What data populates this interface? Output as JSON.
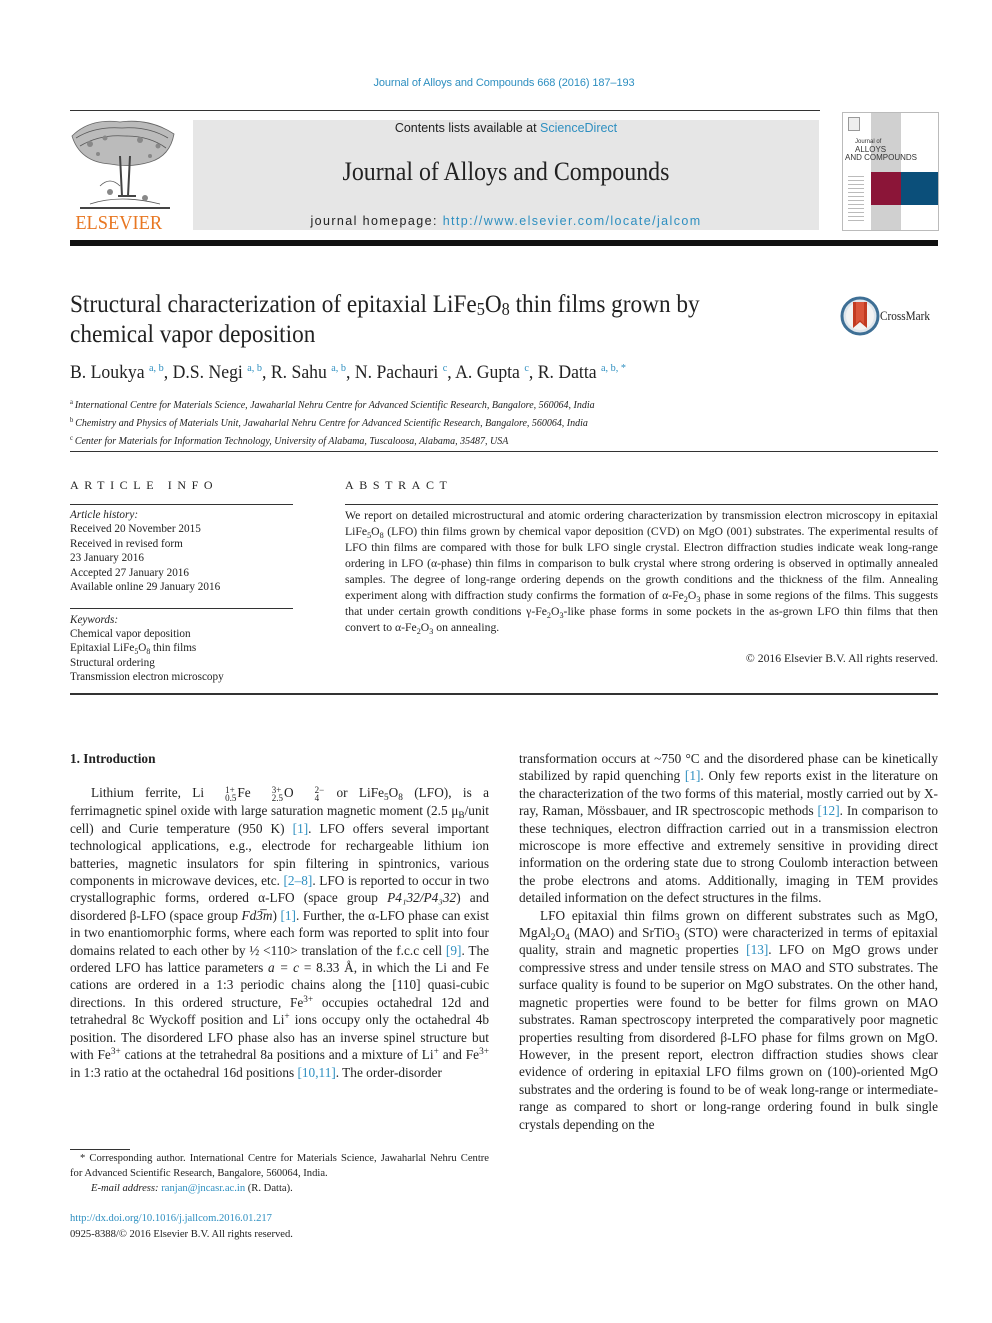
{
  "header": {
    "citation": "Journal of Alloys and Compounds 668 (2016) 187–193",
    "contents_prefix": "Contents lists available at ",
    "contents_link": "ScienceDirect",
    "journal_title": "Journal of Alloys and Compounds",
    "homepage_prefix": "journal homepage: ",
    "homepage_url": "http://www.elsevier.com/locate/jalcom",
    "publisher_logo_text": "ELSEVIER",
    "cover_line1": "Journal of",
    "cover_line2": "ALLOYS",
    "cover_line3": "AND COMPOUNDS",
    "colors": {
      "accent_link": "#2e8fc0",
      "elsevier_orange": "#e87722",
      "cover_red": "#8b1538",
      "cover_blue": "#0b4f7a",
      "masthead_gray": "#e6e6e6"
    }
  },
  "article": {
    "title_pre": "Structural characterization of epitaxial LiFe",
    "title_sub1": "5",
    "title_mid": "O",
    "title_sub2": "8",
    "title_post": " thin films grown by",
    "title_line2": "chemical vapor deposition",
    "crossmark_label": "CrossMark",
    "authors": [
      {
        "name": "B. Loukya",
        "aff": "a, b"
      },
      {
        "name": "D.S. Negi",
        "aff": "a, b"
      },
      {
        "name": "R. Sahu",
        "aff": "a, b"
      },
      {
        "name": "N. Pachauri",
        "aff": "c"
      },
      {
        "name": "A. Gupta",
        "aff": "c"
      },
      {
        "name": "R. Datta",
        "aff": "a, b, *"
      }
    ],
    "affiliations": [
      {
        "key": "a",
        "text": "International Centre for Materials Science, Jawaharlal Nehru Centre for Advanced Scientific Research, Bangalore, 560064, India"
      },
      {
        "key": "b",
        "text": "Chemistry and Physics of Materials Unit, Jawaharlal Nehru Centre for Advanced Scientific Research, Bangalore, 560064, India"
      },
      {
        "key": "c",
        "text": "Center for Materials for Information Technology, University of Alabama, Tuscaloosa, Alabama, 35487, USA"
      }
    ]
  },
  "article_info": {
    "heading": "ARTICLE INFO",
    "history_label": "Article history:",
    "history": [
      "Received 20 November 2015",
      "Received in revised form",
      "23 January 2016",
      "Accepted 27 January 2016",
      "Available online 29 January 2016"
    ],
    "keywords_label": "Keywords:",
    "keywords": [
      "Chemical vapor deposition",
      "Epitaxial LiFe5O8 thin films",
      "Structural ordering",
      "Transmission electron microscopy"
    ]
  },
  "abstract": {
    "heading": "ABSTRACT",
    "p1": "We report on detailed microstructural and atomic ordering characterization by transmission electron microscopy in epitaxial LiFe",
    "p2": "O",
    "p3": " (LFO) thin films grown by chemical vapor deposition (CVD) on MgO (001) substrates. The experimental results of LFO thin films are compared with those for bulk LFO single crystal. Electron diffraction studies indicate weak long-range ordering in LFO (α-phase) thin films in comparison to bulk crystal where strong ordering is observed in optimally annealed samples. The degree of long-range ordering depends on the growth conditions and the thickness of the film. Annealing experiment along with diffraction study confirms the formation of α-Fe",
    "p4": "O",
    "p5": " phase in some regions of the films. This suggests that under certain growth conditions γ-Fe",
    "p6": "O",
    "p7": "-like phase forms in some pockets in the as-grown LFO thin films that then convert to α-Fe",
    "p8": "O",
    "p9": " on annealing.",
    "copyright": "© 2016 Elsevier B.V. All rights reserved."
  },
  "body": {
    "section_title": "1.  Introduction",
    "refs": {
      "r1": "[1]",
      "r2_8": "[2–8]",
      "r9": "[9]",
      "r10_11": "[10,11]",
      "r12": "[12]",
      "r13": "[13]"
    },
    "left": {
      "s1": "Lithium ferrite, Li",
      "s2": " or LiFe",
      "s3": " (LFO), is a ferrimagnetic spinel oxide with large saturation magnetic moment (2.5 μ",
      "s4": "/unit cell) and Curie temperature (950 K) ",
      "s5": ". LFO offers several important technological applications, e.g., electrode for rechargeable lithium ion batteries, magnetic insulators for spin filtering in spintronics, various components in microwave devices, etc. ",
      "s6": ". LFO is reported to occur in two crystallographic forms, ordered α-LFO (space group ",
      "s7": "P4₁32/P4₃32",
      "s8": ") and disordered β-LFO (space group ",
      "s9": "Fd3̅m",
      "s10": ") ",
      "s11": ". Further, the α-LFO phase can exist in two enantiomorphic forms, where each form was reported to split into four domains related to each other by ½ <110> translation of the f.c.c cell ",
      "s12": ". The ordered LFO has lattice parameters ",
      "s13": "a = c",
      "s14": " = 8.33 Å, in which the Li and Fe cations are ordered in a 1:3 periodic chains along the [110] quasi-cubic directions. In this ordered structure, Fe",
      "s15": " occupies octahedral 12d and tetrahedral 8c Wyckoff position and Li",
      "s16": " ions occupy only the octahedral 4b position. The disordered LFO phase also has an inverse spinel structure but with Fe",
      "s17": " cations at the tetrahedral 8a positions and a mixture of Li",
      "s18": " and Fe",
      "s19": " in 1:3 ratio at the octahedral 16d positions ",
      "s20": ". The order-disorder"
    },
    "right": {
      "p1a": "transformation occurs at ~750 °C and the disordered phase can be kinetically stabilized by rapid quenching ",
      "p1b": ". Only few reports exist in the literature on the characterization of the two forms of this material, mostly carried out by X-ray, Raman, Mössbauer, and IR spectroscopic methods ",
      "p1c": ". In comparison to these techniques, electron diffraction carried out in a transmission electron microscope is more effective and extremely sensitive in providing direct information on the ordering state due to strong Coulomb interaction between the probe electrons and atoms. Additionally, imaging in TEM provides detailed information on the defect structures in the films.",
      "p2a": "LFO epitaxial thin films grown on different substrates such as MgO, MgAl",
      "p2b": "O",
      "p2c": " (MAO) and SrTiO",
      "p2d": " (STO) were characterized in terms of epitaxial quality, strain and magnetic properties ",
      "p2e": ". LFO on MgO grows under compressive stress and under tensile stress on MAO and STO substrates. The surface quality is found to be superior on MgO substrates. On the other hand, magnetic properties were found to be better for films grown on MAO substrates. Raman spectroscopy interpreted the comparatively poor magnetic properties resulting from disordered β-LFO phase for films grown on MgO. However, in the present report, electron diffraction studies shows clear evidence of ordering in epitaxial LFO films grown on (100)-oriented MgO substrates and the ordering is found to be of weak long-range or intermediate-range as compared to short or long-range ordering found in bulk single crystals depending on the"
    }
  },
  "footnote": {
    "star_text": "* Corresponding author. International Centre for Materials Science, Jawaharlal Nehru Centre for Advanced Scientific Research, Bangalore, 560064, India.",
    "email_label": "E-mail address: ",
    "email": "ranjan@jncasr.ac.in",
    "email_suffix": " (R. Datta).",
    "doi": "http://dx.doi.org/10.1016/j.jallcom.2016.01.217",
    "issn_line": "0925-8388/© 2016 Elsevier B.V. All rights reserved."
  }
}
